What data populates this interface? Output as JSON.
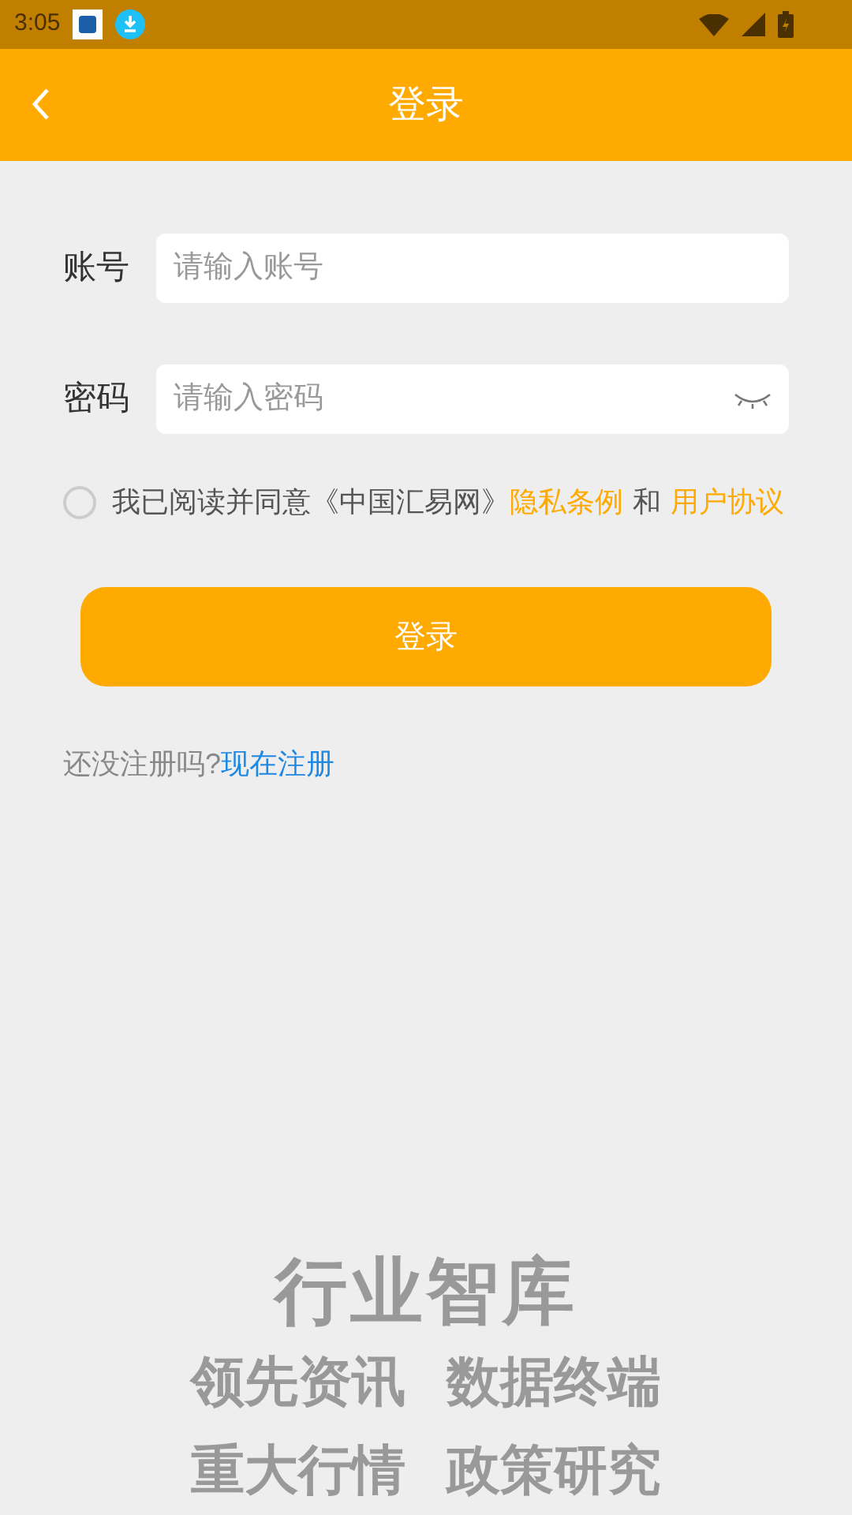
{
  "status_bar": {
    "time": "3:05"
  },
  "header": {
    "title": "登录"
  },
  "fields": [
    {
      "label": "账号",
      "placeholder": "请输入账号",
      "kind": "text"
    },
    {
      "label": "密码",
      "placeholder": "请输入密码",
      "kind": "password"
    }
  ],
  "agreement": {
    "checked": false,
    "text": "我已阅读并同意《中国汇易网》",
    "privacy_link": "隐私条例",
    "and": "和",
    "user_link": "用户协议"
  },
  "login_button": "登录",
  "register": {
    "prompt": "还没注册吗?",
    "link": "现在注册"
  },
  "slogan": {
    "title": "行业智库",
    "lines": [
      [
        "领先资讯",
        "数据终端"
      ],
      [
        "重大行情",
        "政策研究"
      ]
    ]
  }
}
